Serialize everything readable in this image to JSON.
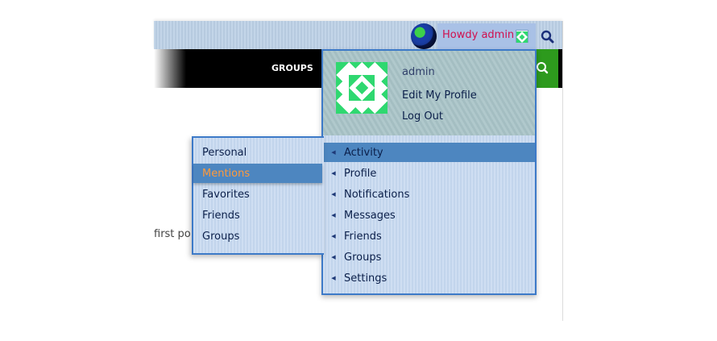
{
  "adminbar": {
    "howdy": "Howdy admin",
    "search_icon": "search-icon",
    "globe_icon": "globe-logo-icon"
  },
  "nav": {
    "groups_label": "GROUPS"
  },
  "content": {
    "post_fragment": "first po"
  },
  "profile": {
    "name": "admin",
    "edit_profile": "Edit My Profile",
    "log_out": "Log Out"
  },
  "menu": {
    "items": [
      {
        "label": "Activity"
      },
      {
        "label": "Profile"
      },
      {
        "label": "Notifications"
      },
      {
        "label": "Messages"
      },
      {
        "label": "Friends"
      },
      {
        "label": "Groups"
      },
      {
        "label": "Settings"
      }
    ],
    "active_index": 0
  },
  "submenu": {
    "items": [
      {
        "label": "Personal"
      },
      {
        "label": "Mentions"
      },
      {
        "label": "Favorites"
      },
      {
        "label": "Friends"
      },
      {
        "label": "Groups"
      }
    ],
    "active_index": 1
  },
  "colors": {
    "accent": "#4d86c0",
    "howdy_text": "#d0104f",
    "active_sub_text": "#ff9a3c",
    "nav_search_bg": "#2d9a1d"
  }
}
